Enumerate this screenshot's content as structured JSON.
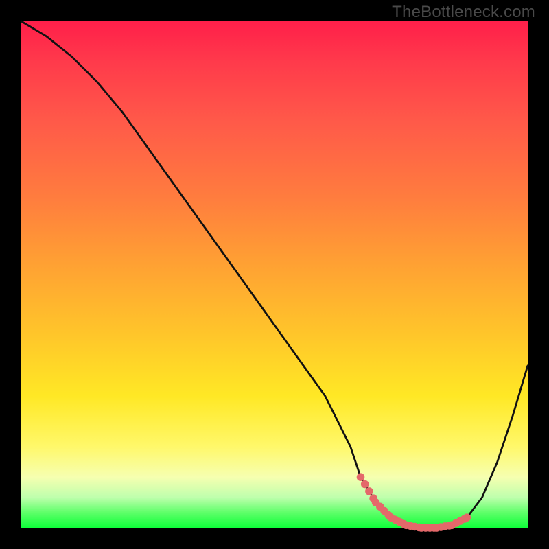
{
  "watermark": "TheBottleneck.com",
  "colors": {
    "background": "#000000",
    "curve": "#111111",
    "dots": "#e4686a",
    "gradient_top": "#ff1f4a",
    "gradient_bottom": "#0fff3a"
  },
  "chart_data": {
    "type": "line",
    "title": "",
    "xlabel": "",
    "ylabel": "",
    "xlim": [
      0,
      100
    ],
    "ylim": [
      0,
      100
    ],
    "grid": false,
    "legend": false,
    "x": [
      0,
      5,
      10,
      15,
      20,
      25,
      30,
      35,
      40,
      45,
      50,
      55,
      60,
      65,
      67,
      70,
      73,
      76,
      79,
      82,
      85,
      88,
      91,
      94,
      97,
      100
    ],
    "values": [
      100,
      97,
      93,
      88,
      82,
      75,
      68,
      61,
      54,
      47,
      40,
      33,
      26,
      16,
      10,
      5,
      2,
      0.5,
      0,
      0,
      0.5,
      2,
      6,
      13,
      22,
      32
    ],
    "dot_region_x": [
      67,
      70,
      73,
      76,
      79,
      82,
      85,
      88
    ],
    "dot_region_y": [
      10,
      5,
      2,
      0.5,
      0,
      0,
      0.5,
      2
    ],
    "annotations": []
  }
}
